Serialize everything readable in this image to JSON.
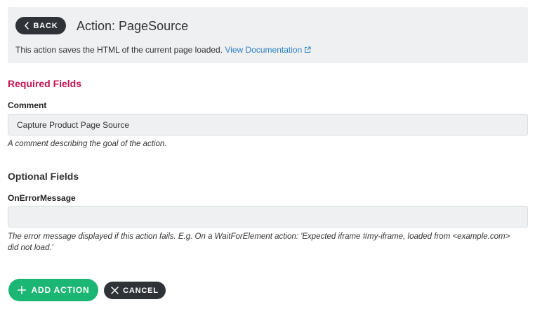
{
  "header": {
    "back_label": "BACK",
    "title": "Action: PageSource",
    "description": "This action saves the HTML of the current page loaded.",
    "doc_link_label": "View Documentation"
  },
  "required": {
    "section_title": "Required Fields",
    "comment_label": "Comment",
    "comment_value": "Capture Product Page Source",
    "comment_help": "A comment describing the goal of the action."
  },
  "optional": {
    "section_title": "Optional Fields",
    "error_label": "OnErrorMessage",
    "error_value": "",
    "error_help": "The error message displayed if this action fails. E.g. On a WaitForElement action: 'Expected iframe #my-iframe, loaded from <example.com> did not load.'"
  },
  "footer": {
    "add_label": "ADD ACTION",
    "cancel_label": "CANCEL"
  },
  "colors": {
    "required_title": "#c3154e",
    "link": "#2a7fc9",
    "primary": "#1bb574",
    "dark_button": "#2f3338"
  },
  "icons": {
    "back": "chevron-left-icon",
    "external": "external-link-icon",
    "add": "plus-icon",
    "cancel": "close-icon"
  }
}
